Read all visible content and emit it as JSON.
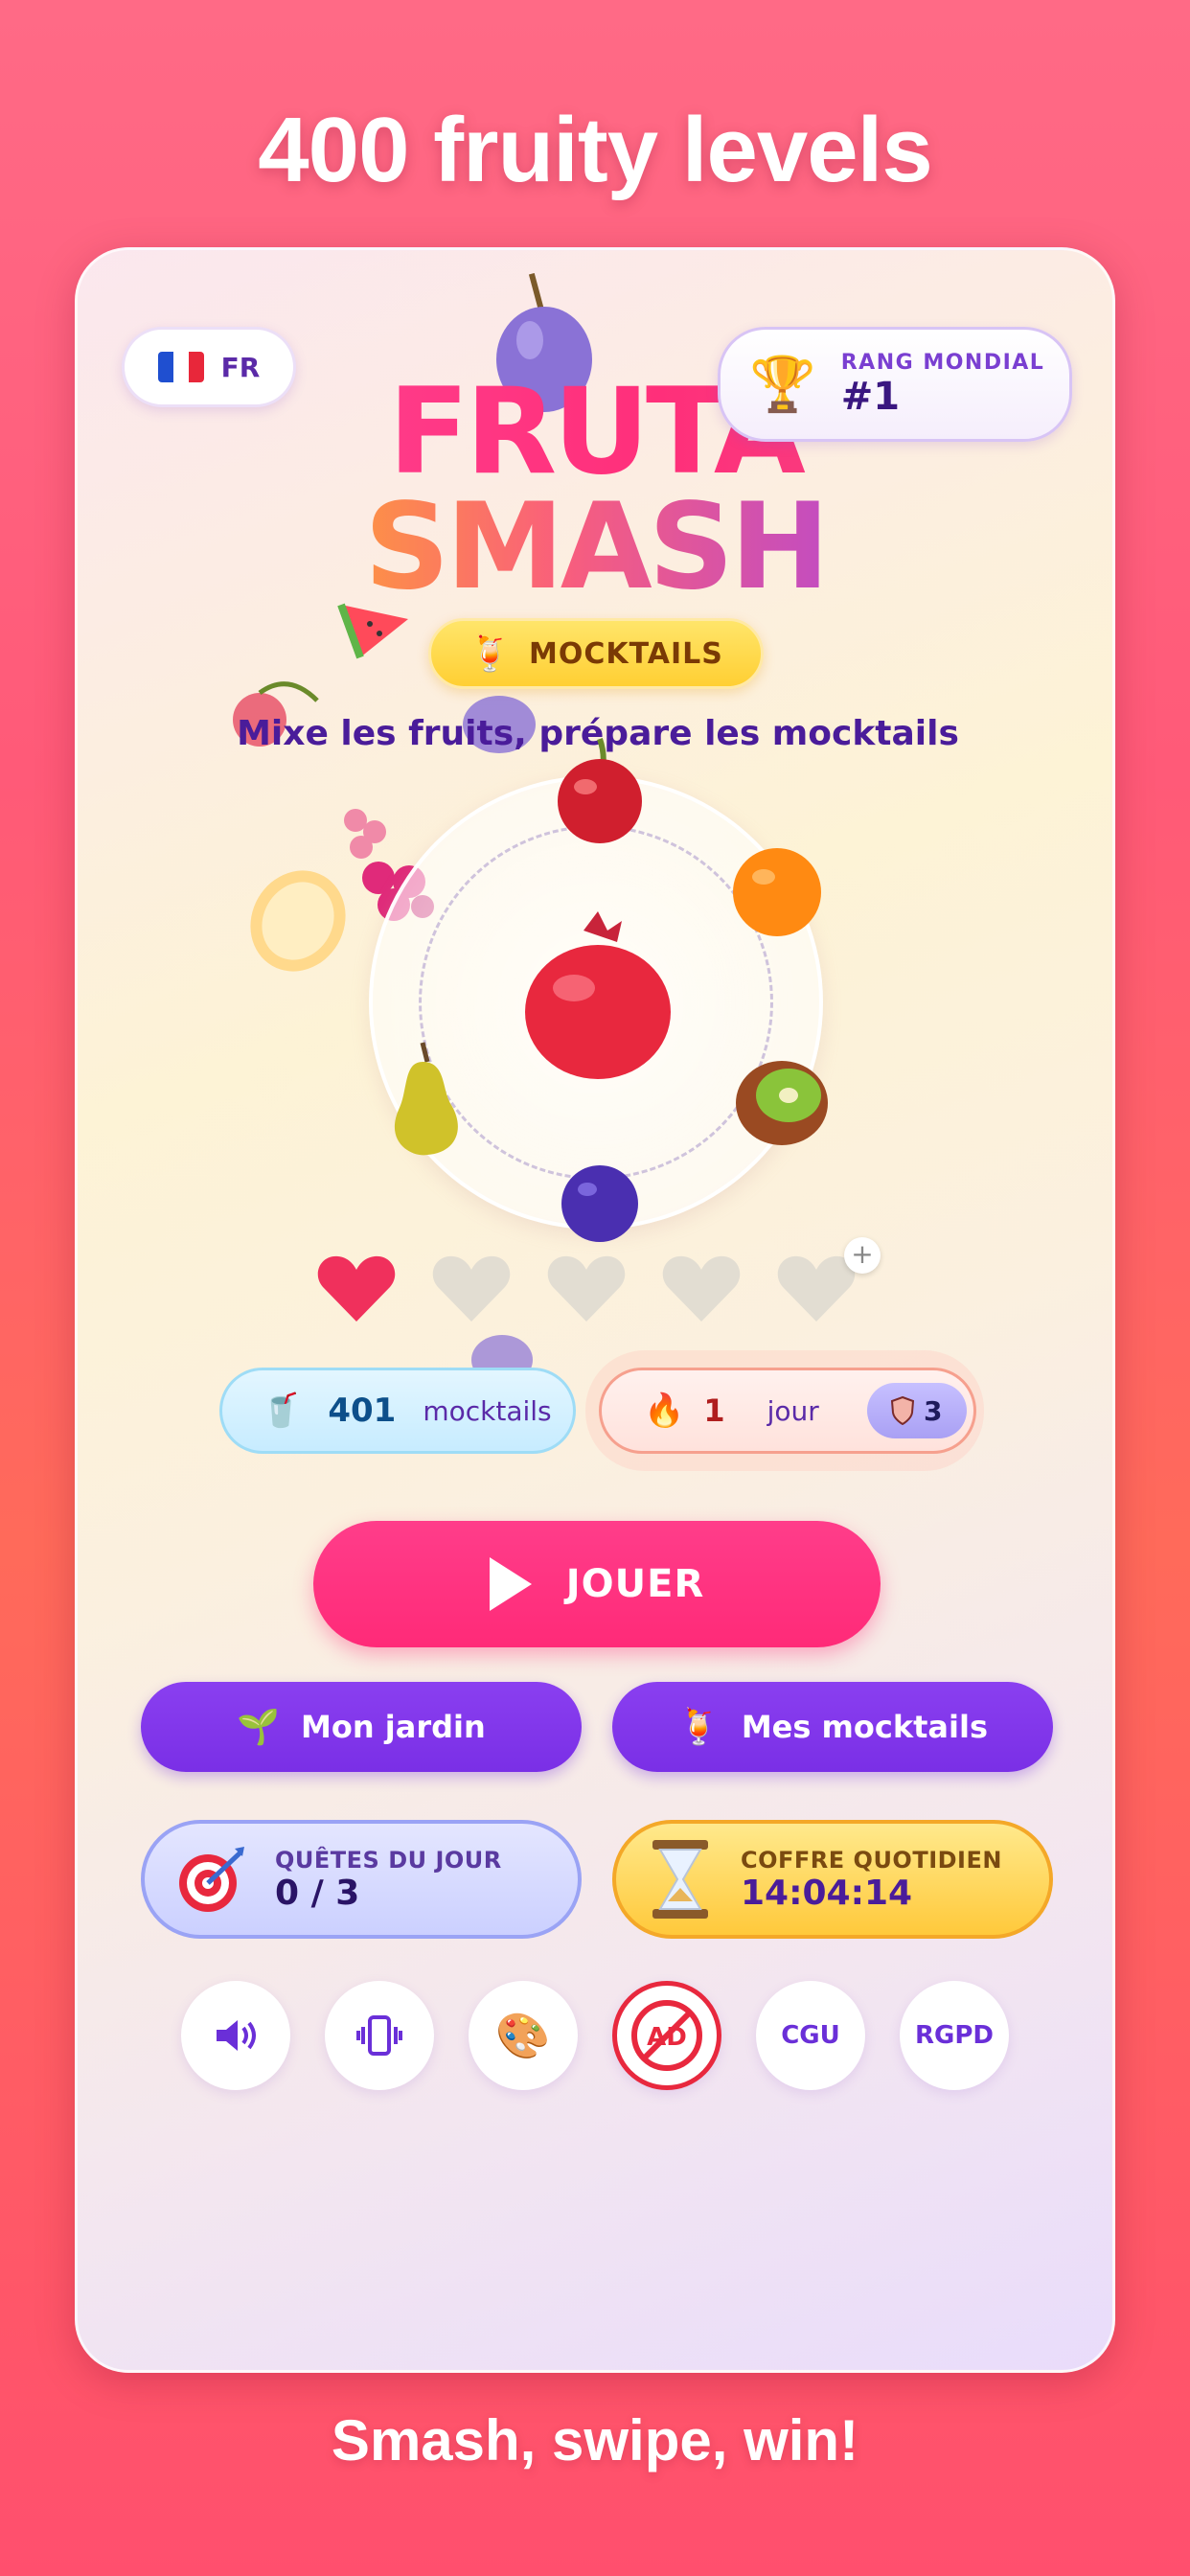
{
  "headline": "400 fruity levels",
  "footer": "Smash, swipe, win!",
  "language": {
    "code": "FR"
  },
  "rank": {
    "label": "RANG MONDIAL",
    "value": "#1"
  },
  "logo": {
    "line1": "FRUTA",
    "line2": "SMASH"
  },
  "mode_badge": {
    "label": "MOCKTAILS"
  },
  "tagline": "Mixe les fruits, prépare les mocktails",
  "lives": {
    "filled": 1,
    "total": 5
  },
  "stats": {
    "mocktails_count": "401",
    "mocktails_label": "mocktails",
    "streak_count": "1",
    "streak_label": "jour",
    "shield_count": "3"
  },
  "play_button": "JOUER",
  "buttons": {
    "garden": "Mon jardin",
    "my_mocktails": "Mes mocktails"
  },
  "quests": {
    "label": "QUÊTES DU JOUR",
    "value": "0 / 3"
  },
  "chest": {
    "label": "COFFRE QUOTIDIEN",
    "value": "14:04:14"
  },
  "bottom_buttons": {
    "cgu": "CGU",
    "rgpd": "RGPD"
  },
  "colors": {
    "accent_pink": "#ff2a78",
    "accent_purple": "#7a2fe6",
    "text_purple": "#4a1c9a"
  }
}
